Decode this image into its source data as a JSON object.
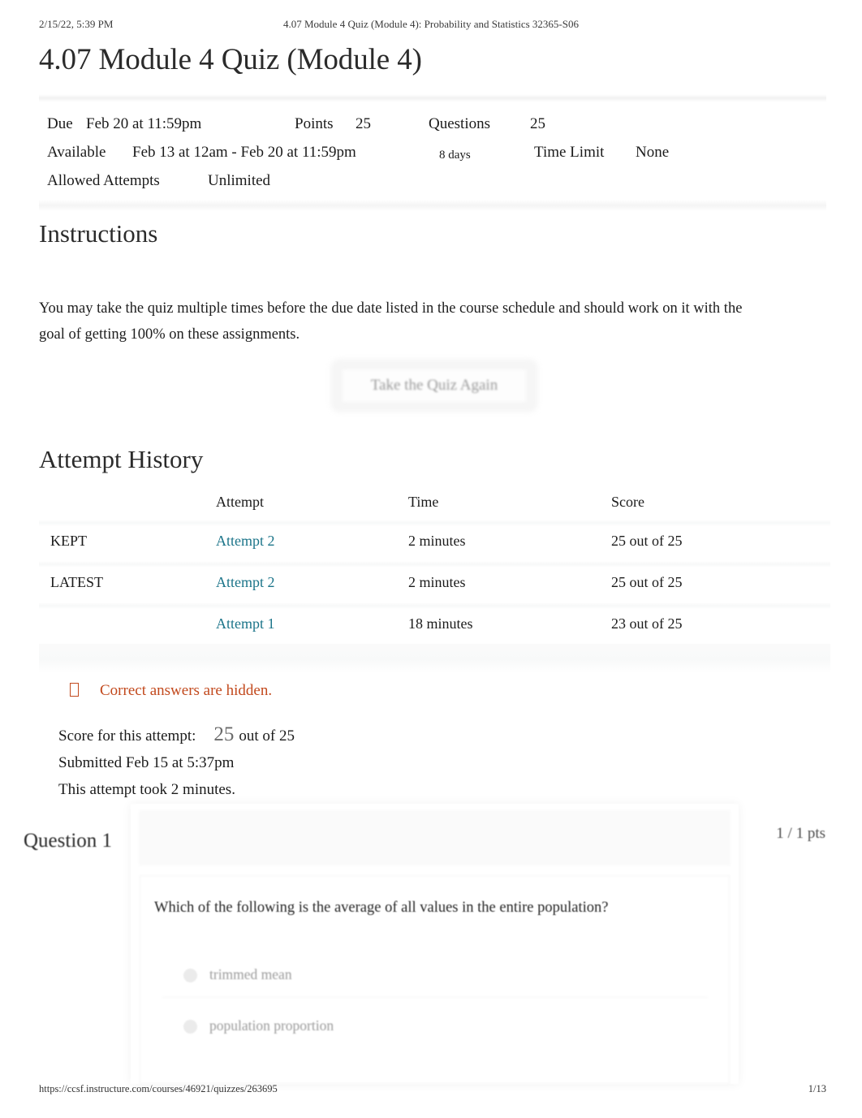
{
  "print_header": {
    "date": "2/15/22, 5:39 PM",
    "title": "4.07 Module 4 Quiz (Module 4): Probability and Statistics 32365-S06"
  },
  "page_title": "4.07 Module 4 Quiz (Module 4)",
  "quiz_meta": {
    "due_label": "Due",
    "due_value": "Feb 20 at 11:59pm",
    "points_label": "Points",
    "points_value": "25",
    "questions_label": "Questions",
    "questions_value": "25",
    "available_label": "Available",
    "available_value": "Feb 13 at 12am - Feb 20 at 11:59pm",
    "available_duration": "8 days",
    "time_limit_label": "Time Limit",
    "time_limit_value": "None",
    "allowed_attempts_label": "Allowed Attempts",
    "allowed_attempts_value": "Unlimited"
  },
  "instructions": {
    "heading": "Instructions",
    "body": "You may take the quiz multiple times before the due date listed in the course schedule and should work on it with the goal of getting 100% on these assignments."
  },
  "retake_button": {
    "label": "Take the Quiz Again"
  },
  "attempt_history": {
    "heading": "Attempt History",
    "columns": {
      "tag": "",
      "attempt": "Attempt",
      "time": "Time",
      "score": "Score"
    },
    "rows": [
      {
        "tag": "KEPT",
        "attempt": "Attempt 2",
        "time": "2 minutes",
        "score": "25 out of 25"
      },
      {
        "tag": "LATEST",
        "attempt": "Attempt 2",
        "time": "2 minutes",
        "score": "25 out of 25"
      },
      {
        "tag": "",
        "attempt": "Attempt 1",
        "time": "18 minutes",
        "score": "23 out of 25"
      }
    ]
  },
  "notice": {
    "icon": "warning-icon",
    "text": "Correct answers are hidden.",
    "color": "#c2491d"
  },
  "score_summary": {
    "score_label": "Score for this attempt:",
    "score_value": "25",
    "score_out_of": "out of 25",
    "submitted": "Submitted Feb 15 at 5:37pm",
    "duration": "This attempt took 2 minutes."
  },
  "question": {
    "title": "Question 1",
    "points": "1 / 1 pts",
    "prompt": "Which of the following is the average of all values in the entire population?",
    "answers": [
      {
        "label": "trimmed mean"
      },
      {
        "label": "population proportion"
      }
    ]
  },
  "footer": {
    "url": "https://ccsf.instructure.com/courses/46921/quizzes/263695",
    "page": "1/13"
  },
  "colors": {
    "link": "#1b7489",
    "notice": "#c2491d",
    "text": "#1b1b1b"
  }
}
